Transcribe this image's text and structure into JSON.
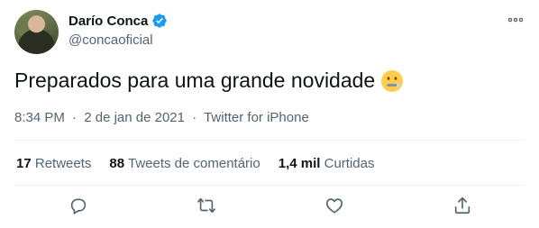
{
  "user": {
    "display_name": "Darío Conca",
    "handle": "@concaoficial",
    "verified_icon": "verified-badge-icon",
    "avatar_icon": "profile-photo"
  },
  "tweet": {
    "text": "Preparados para uma grande novidade",
    "emoji": "zipper-mouth-face",
    "time": "8:34 PM",
    "date": "2 de jan de 2021",
    "source": "Twitter for iPhone",
    "separator": "·"
  },
  "stats": {
    "retweets_count": "17",
    "retweets_label": "Retweets",
    "replies_count": "88",
    "replies_label": "Tweets de comentário",
    "likes_count": "1,4 mil",
    "likes_label": "Curtidas"
  },
  "actions": [
    "reply-icon",
    "retweet-icon",
    "like-icon",
    "share-icon"
  ],
  "colors": {
    "text": "#0f1419",
    "secondary": "#536471",
    "verified": "#1d9bf0",
    "divider": "#eff3f4"
  }
}
